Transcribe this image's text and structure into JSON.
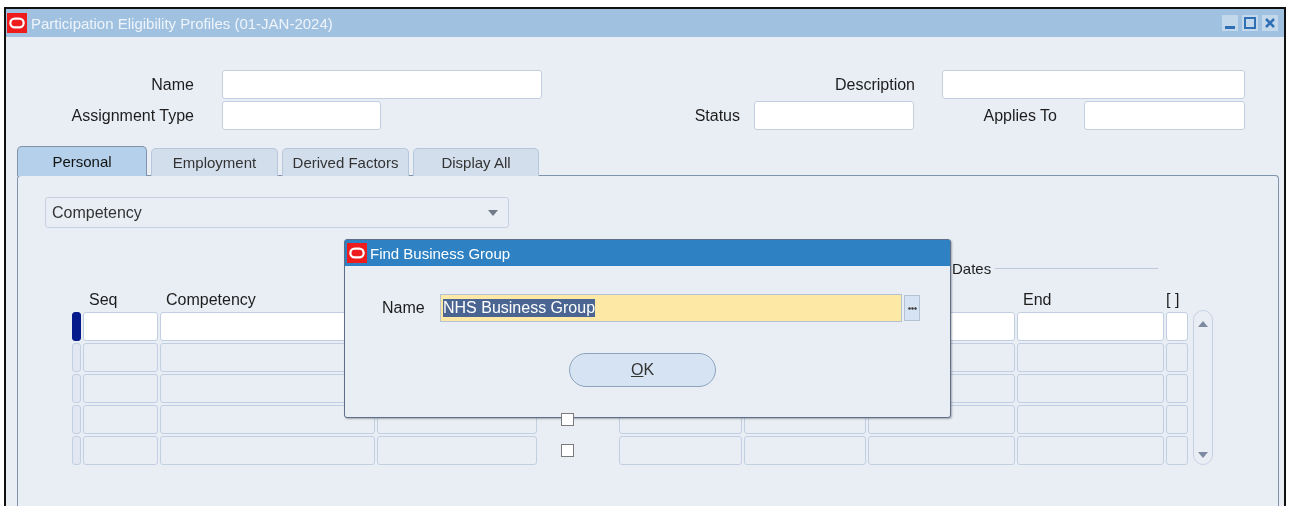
{
  "window": {
    "title": "Participation Eligibility Profiles (01-JAN-2024)"
  },
  "header_fields": {
    "name": {
      "label": "Name"
    },
    "description": {
      "label": "Description"
    },
    "assignment_type": {
      "label": "Assignment Type"
    },
    "status": {
      "label": "Status"
    },
    "applies_to": {
      "label": "Applies To"
    }
  },
  "tabs": [
    {
      "label": "Personal",
      "selected": true
    },
    {
      "label": "Employment",
      "selected": false
    },
    {
      "label": "Derived Factors",
      "selected": false
    },
    {
      "label": "Display All",
      "selected": false
    }
  ],
  "factor_dropdown": {
    "value": "Competency"
  },
  "table": {
    "group_label": "Dates",
    "columns": [
      {
        "kind": "text",
        "label": "Seq"
      },
      {
        "kind": "text",
        "label": "Competency"
      },
      {
        "kind": "text"
      },
      {
        "kind": "check"
      },
      {
        "kind": "text"
      },
      {
        "kind": "text"
      },
      {
        "kind": "text"
      },
      {
        "kind": "text",
        "label": "End"
      },
      {
        "kind": "text",
        "label": "[ ]"
      }
    ],
    "rows": [
      {
        "current": true
      },
      {
        "current": false
      },
      {
        "current": false
      },
      {
        "current": false,
        "checked": false
      },
      {
        "current": false,
        "checked": false
      }
    ]
  },
  "dialog": {
    "title": "Find Business Group",
    "field_label": "Name",
    "value": "NHS Business Group",
    "value_selected": true,
    "ok_button": "OK"
  }
}
